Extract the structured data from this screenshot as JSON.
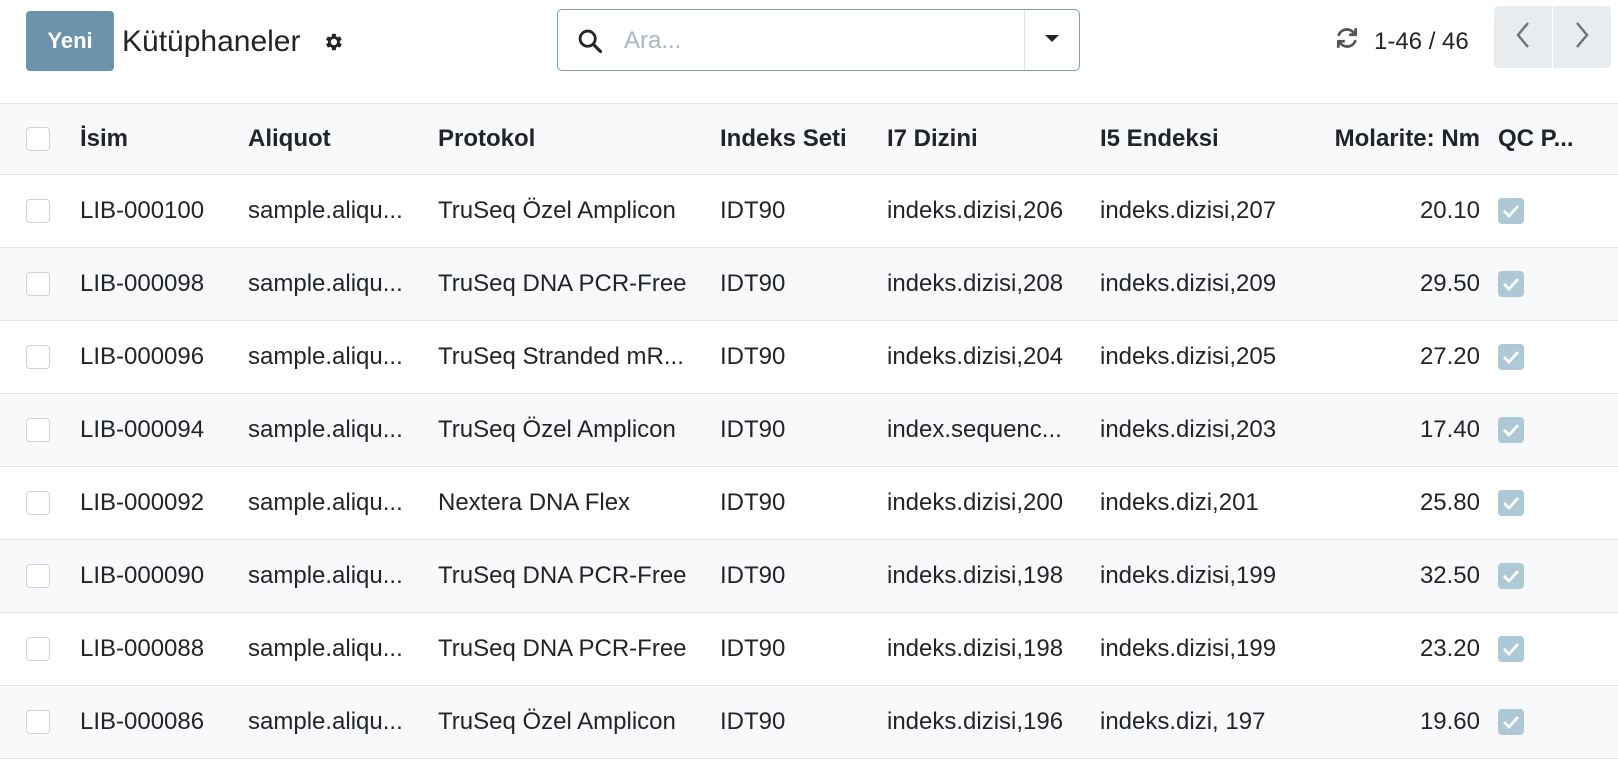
{
  "toolbar": {
    "new_label": "Yeni",
    "title": "Kütüphaneler"
  },
  "search": {
    "placeholder": "Ara..."
  },
  "pager": {
    "value": "1-46 / 46"
  },
  "table": {
    "columns": {
      "name": "İsim",
      "aliquot": "Aliquot",
      "protocol": "Protokol",
      "index_set": "Indeks Seti",
      "i7": "I7 Dizini",
      "i5": "I5 Endeksi",
      "molarity": "Molarite: Nm",
      "qc": "QC P..."
    },
    "rows": [
      {
        "name": "LIB-000100",
        "aliquot": "sample.aliqu...",
        "protocol": "TruSeq Özel Amplicon",
        "index_set": "IDT90",
        "i7": "indeks.dizisi,206",
        "i5": "indeks.dizisi,207",
        "molarity": "20.10",
        "qc": true
      },
      {
        "name": "LIB-000098",
        "aliquot": "sample.aliqu...",
        "protocol": "TruSeq DNA PCR-Free",
        "index_set": "IDT90",
        "i7": "indeks.dizisi,208",
        "i5": "indeks.dizisi,209",
        "molarity": "29.50",
        "qc": true
      },
      {
        "name": "LIB-000096",
        "aliquot": "sample.aliqu...",
        "protocol": "TruSeq Stranded mR...",
        "index_set": "IDT90",
        "i7": "indeks.dizisi,204",
        "i5": "indeks.dizisi,205",
        "molarity": "27.20",
        "qc": true
      },
      {
        "name": "LIB-000094",
        "aliquot": "sample.aliqu...",
        "protocol": "TruSeq Özel Amplicon",
        "index_set": "IDT90",
        "i7": "index.sequenc...",
        "i5": "indeks.dizisi,203",
        "molarity": "17.40",
        "qc": true
      },
      {
        "name": "LIB-000092",
        "aliquot": "sample.aliqu...",
        "protocol": "Nextera DNA Flex",
        "index_set": "IDT90",
        "i7": "indeks.dizisi,200",
        "i5": "indeks.dizi,201",
        "molarity": "25.80",
        "qc": true
      },
      {
        "name": "LIB-000090",
        "aliquot": "sample.aliqu...",
        "protocol": "TruSeq DNA PCR-Free",
        "index_set": "IDT90",
        "i7": "indeks.dizisi,198",
        "i5": "indeks.dizisi,199",
        "molarity": "32.50",
        "qc": true
      },
      {
        "name": "LIB-000088",
        "aliquot": "sample.aliqu...",
        "protocol": "TruSeq DNA PCR-Free",
        "index_set": "IDT90",
        "i7": "indeks.dizisi,198",
        "i5": "indeks.dizisi,199",
        "molarity": "23.20",
        "qc": true
      },
      {
        "name": "LIB-000086",
        "aliquot": "sample.aliqu...",
        "protocol": "TruSeq Özel Amplicon",
        "index_set": "IDT90",
        "i7": "indeks.dizisi,196",
        "i5": "indeks.dizi, 197",
        "molarity": "19.60",
        "qc": true
      }
    ]
  }
}
